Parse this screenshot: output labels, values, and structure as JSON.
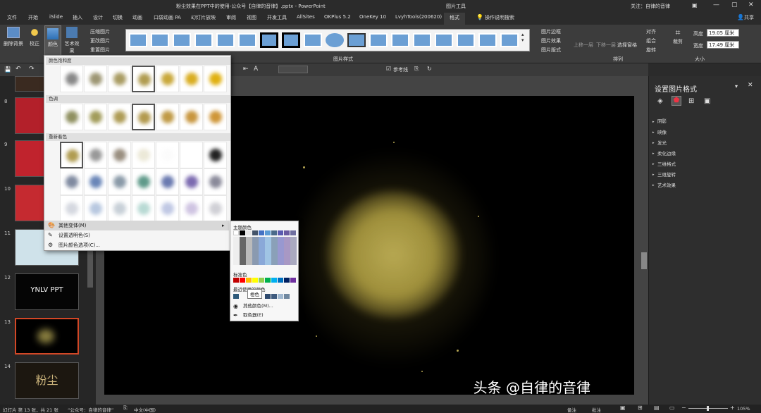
{
  "titlebar": {
    "doc_title": "粉尘效果在PPT中的使用-公众号【自律的音律】.pptx - PowerPoint",
    "context_tool": "图片工具",
    "account": "关注：自律的音律"
  },
  "tabs": [
    "文件",
    "开始",
    "iSlide",
    "插入",
    "设计",
    "切换",
    "动画",
    "口袋动画 PA",
    "幻灯片放映",
    "审阅",
    "视图",
    "开发工具",
    "AllSites",
    "OKPlus 5.2",
    "OneKey 10",
    "LvyhTools(200620)",
    "格式"
  ],
  "tab_tell_me": "操作说明搜索",
  "tab_share": "共享",
  "ribbon": {
    "remove_bg": "删除背景",
    "correct": "校正",
    "color": "颜色",
    "art": "艺术效果",
    "compress": "压缩图片",
    "change": "更改图片",
    "reset": "重置图片",
    "pic_border": "图片边框",
    "pic_effect": "图片效果",
    "pic_layout": "图片版式",
    "styles_group": "图片样式",
    "bring_fwd": "上移一层",
    "send_back": "下移一层",
    "sel_pane": "选择窗格",
    "align": "对齐",
    "group": "组合",
    "rotate": "旋转",
    "arrange_group": "排列",
    "crop": "裁剪",
    "height": "19.05 厘米",
    "width": "17.49 厘米",
    "height_label": "高度",
    "width_label": "宽度",
    "size_group": "大小"
  },
  "qat": {
    "ref_line": "参考线"
  },
  "dropdown": {
    "sec1": "颜色饱和度",
    "sec2": "色调",
    "sec3": "重新着色",
    "item_more": "其他变体(M)",
    "item_transparent": "设置透明色(S)",
    "item_options": "图片颜色选项(C)..."
  },
  "submenu": {
    "theme": "主题颜色",
    "standard": "标准色",
    "recent": "最近使用的颜色",
    "tooltip": "橙色",
    "more": "其他颜色(M)...",
    "eyedrop": "取色器(E)"
  },
  "pane": {
    "title": "设置图片格式",
    "items": [
      "阴影",
      "映像",
      "发光",
      "柔化边缘",
      "三维格式",
      "三维旋转",
      "艺术效果"
    ]
  },
  "thumbnails": [
    "8",
    "9",
    "10",
    "11",
    "12",
    "13",
    "14"
  ],
  "thumb_text": {
    "t12": "YNLV PPT",
    "t14": "粉尘"
  },
  "status": {
    "slide": "幻灯片 第 13 张，共 21 张",
    "theme": "“公众号：自律的音律”",
    "lang": "中文(中国)",
    "notes": "备注",
    "comments": "批注",
    "zoom": "105%"
  },
  "watermark": "头条 @自律的音律",
  "colors": {
    "accent": "#b7472a",
    "dust": "#c2b35a"
  }
}
